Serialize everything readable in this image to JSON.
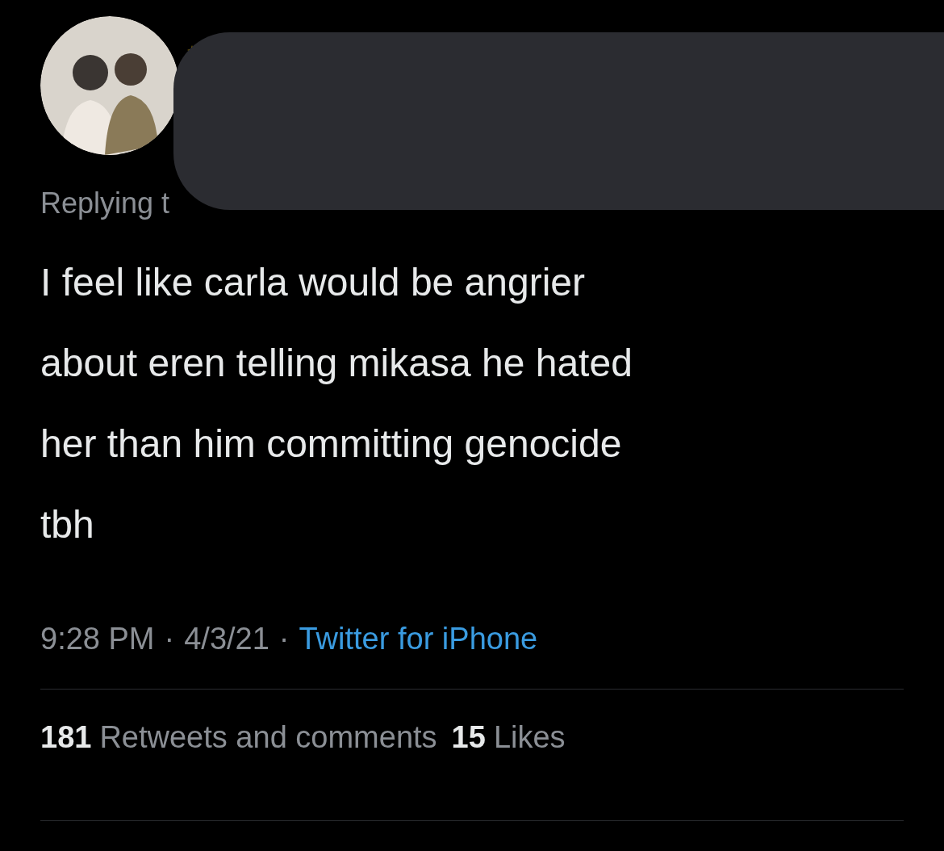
{
  "reply_context": {
    "text": "Replying t"
  },
  "tweet": {
    "text": "I feel like carla would be angrier\nabout eren telling mikasa he hated\nher than him committing genocide\ntbh"
  },
  "meta": [
    {
      "text": "9:28 PM",
      "kind": "plain"
    },
    {
      "text": "·",
      "kind": "separator"
    },
    {
      "text": "4/3/21",
      "kind": "plain"
    },
    {
      "text": "·",
      "kind": "separator"
    },
    {
      "text": "Twitter for iPhone",
      "kind": "link"
    }
  ],
  "stats": [
    {
      "count": "181",
      "label": "Retweets and comments"
    },
    {
      "count": "15",
      "label": "Likes"
    }
  ]
}
